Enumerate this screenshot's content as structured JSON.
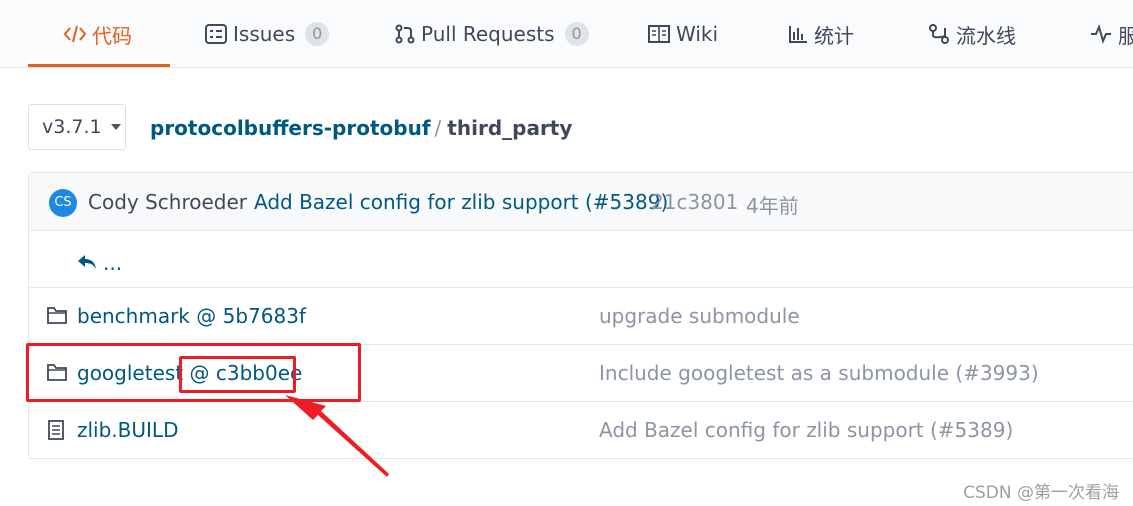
{
  "tabs": [
    {
      "label": "代码",
      "icon": "code-icon",
      "active": true
    },
    {
      "label": "Issues",
      "icon": "issues-icon",
      "count": "0"
    },
    {
      "label": "Pull Requests",
      "icon": "pull-request-icon",
      "count": "0"
    },
    {
      "label": "Wiki",
      "icon": "book-icon"
    },
    {
      "label": "统计",
      "icon": "bar-chart-icon"
    },
    {
      "label": "流水线",
      "icon": "pipeline-icon"
    },
    {
      "label": "服",
      "icon": "pulse-icon"
    }
  ],
  "branch": {
    "label": "v3.7.1"
  },
  "breadcrumb": {
    "repo": "protocolbuffers-protobuf",
    "separator": "/",
    "dir": "third_party"
  },
  "commit": {
    "avatar_initials": "CS",
    "author": "Cody Schroeder",
    "message": "Add Bazel config for zlib support (#5389)",
    "sha": "21c3801",
    "time": "4年前"
  },
  "parent": {
    "label": "..."
  },
  "files": [
    {
      "name": "benchmark",
      "ref": "@ 5b7683f",
      "message": "upgrade submodule",
      "icon": "folder-icon"
    },
    {
      "name": "googletest",
      "ref": "@ c3bb0ee",
      "message": "Include googletest as a submodule (#3993)",
      "icon": "folder-icon"
    },
    {
      "name": "zlib.BUILD",
      "message": "Add Bazel config for zlib support (#5389)",
      "icon": "file-icon"
    }
  ],
  "colors": {
    "accent": "#e4601d",
    "link": "#005980",
    "annotation": "#ee1c24"
  },
  "watermark": "CSDN @第一次看海"
}
